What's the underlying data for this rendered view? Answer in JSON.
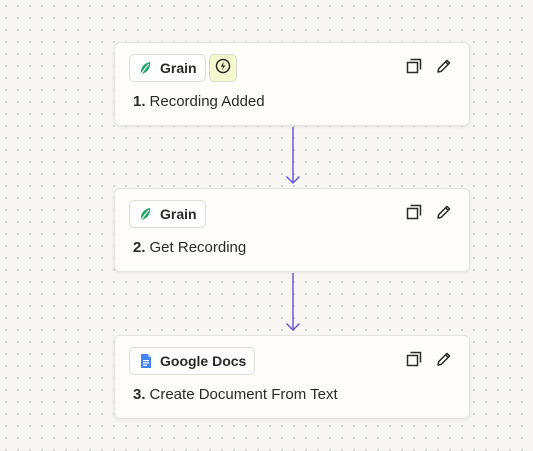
{
  "colors": {
    "canvas_bg": "#f7f6f3",
    "card_bg": "#fffdf9",
    "connector": "#6b5ad6",
    "grain_green": "#1fa463",
    "trigger_bg": "#f3f8cf",
    "google_docs_blue": "#4285f4"
  },
  "steps": [
    {
      "number": "1.",
      "title": "Recording Added",
      "app": {
        "name": "Grain",
        "icon": "grain-logo-icon"
      },
      "is_trigger": true,
      "trigger_icon": "lightning-bolt-icon",
      "actions": [
        "duplicate-icon",
        "edit-pencil-icon"
      ]
    },
    {
      "number": "2.",
      "title": "Get Recording",
      "app": {
        "name": "Grain",
        "icon": "grain-logo-icon"
      },
      "is_trigger": false,
      "actions": [
        "duplicate-icon",
        "edit-pencil-icon"
      ]
    },
    {
      "number": "3.",
      "title": "Create Document From Text",
      "app": {
        "name": "Google Docs",
        "icon": "google-docs-icon"
      },
      "is_trigger": false,
      "actions": [
        "duplicate-icon",
        "edit-pencil-icon"
      ]
    }
  ]
}
